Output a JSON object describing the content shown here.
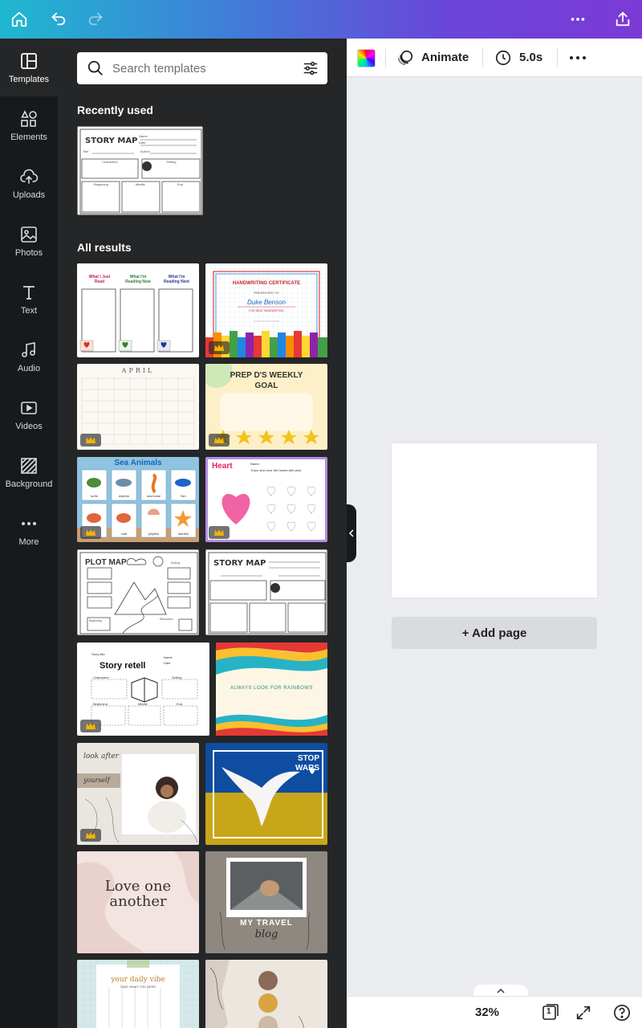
{
  "topbar": {
    "home_icon": "home-icon",
    "undo_icon": "undo-icon",
    "redo_icon": "redo-icon",
    "more_icon": "more-icon",
    "share_icon": "share-icon"
  },
  "rail": {
    "items": [
      {
        "label": "Templates",
        "icon": "templates-icon",
        "active": true
      },
      {
        "label": "Elements",
        "icon": "elements-icon"
      },
      {
        "label": "Uploads",
        "icon": "uploads-icon"
      },
      {
        "label": "Photos",
        "icon": "photos-icon"
      },
      {
        "label": "Text",
        "icon": "text-icon"
      },
      {
        "label": "Audio",
        "icon": "audio-icon"
      },
      {
        "label": "Videos",
        "icon": "videos-icon"
      },
      {
        "label": "Background",
        "icon": "background-icon"
      },
      {
        "label": "More",
        "icon": "more-icon"
      }
    ]
  },
  "panel": {
    "search": {
      "placeholder": "Search templates"
    },
    "recently_used_title": "Recently used",
    "all_results_title": "All results",
    "recent": [
      {
        "title": "STORY MAP",
        "labels": [
          "Name",
          "Date",
          "Title",
          "Author",
          "Characters",
          "Setting",
          "Beginning",
          "Middle",
          "End"
        ]
      }
    ],
    "results": [
      {
        "kind": "reading",
        "headers": [
          "What I Just Read",
          "What I'm Reading Now",
          "What I'm Reading Next"
        ],
        "premium": false
      },
      {
        "kind": "certificate",
        "title": "HANDWRITING CERTIFICATE",
        "presented": "PRESENTED TO",
        "name": "Duke Benson",
        "note": "FOR NEAT HANDWRITING",
        "premium": true
      },
      {
        "kind": "calendar",
        "title": "APRIL",
        "premium": true
      },
      {
        "kind": "goal",
        "title": "PREP D'S WEEKLY GOAL",
        "premium": true
      },
      {
        "kind": "sea",
        "title": "Sea Animals",
        "animals": [
          "turtle",
          "dolphin",
          "sea horse",
          "fish",
          "crab",
          "crab",
          "jellyfish",
          "starfish"
        ],
        "premium": true
      },
      {
        "kind": "heart",
        "title": "Heart",
        "name_label": "Name:",
        "instruction": "Trace and color the hearts with pink.",
        "premium": true
      },
      {
        "kind": "plotmap",
        "title": "PLOT MAP",
        "labels": [
          "Ending",
          "Beginning",
          "Resolution",
          "Problem"
        ],
        "premium": false
      },
      {
        "kind": "storymap",
        "title": "STORY MAP",
        "premium": false
      },
      {
        "kind": "retell",
        "title": "Story retell",
        "story_title": "Story title",
        "labels": [
          "Name",
          "Date",
          "Characters",
          "Setting",
          "Beginning",
          "Middle",
          "End"
        ],
        "premium": true
      },
      {
        "kind": "rainbow",
        "text": "ALWAYS LOOK FOR RAINBOWS",
        "premium": false
      },
      {
        "kind": "lookafter",
        "text1": "look after",
        "text2": "yourself",
        "premium": true
      },
      {
        "kind": "stopwars",
        "text": "STOP WARS",
        "premium": false
      },
      {
        "kind": "love",
        "text": "Love one another",
        "premium": false
      },
      {
        "kind": "travel",
        "text1": "MY TRAVEL",
        "text2": "blog",
        "premium": false
      },
      {
        "kind": "vibe",
        "text1": "your daily vibe",
        "text2": "TAKE WHAT YOU NEED",
        "premium": false
      },
      {
        "kind": "dots",
        "premium": false
      }
    ]
  },
  "canvas": {
    "toolbar": {
      "animate": "Animate",
      "duration": "5.0s"
    },
    "add_page": "+ Add page",
    "zoom": "32%",
    "page_count": "1",
    "bottom_tab": "^"
  },
  "colors": {
    "accent": "#7c3ad6",
    "rail": "#18191b",
    "panel": "#252627",
    "premium_crown": "#f5b400"
  }
}
